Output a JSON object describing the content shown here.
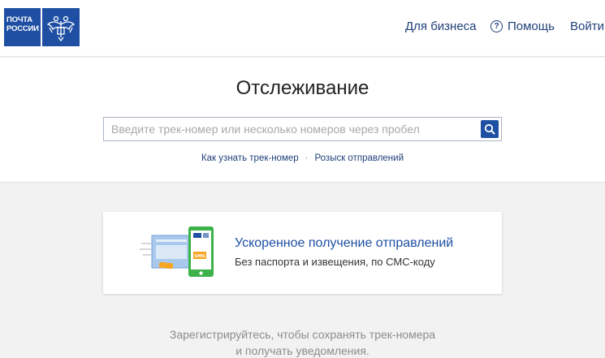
{
  "header": {
    "logo_text_line1": "ПОЧТА",
    "logo_text_line2": "РОССИИ",
    "nav": {
      "business": "Для бизнеса",
      "help": "Помощь",
      "login": "Войти"
    }
  },
  "tracking": {
    "title": "Отслеживание",
    "search_placeholder": "Введите трек-номер или несколько номеров через пробел",
    "links": {
      "how_to": "Как узнать трек-номер",
      "separator": "·",
      "search_shipments": "Розыск отправлений"
    }
  },
  "promo": {
    "title": "Ускоренное получение отправлений",
    "subtitle": "Без паспорта и извещения, по СМС-коду",
    "sms_label": "SMS"
  },
  "register": {
    "line1": "Зарегистрируйтесь, чтобы сохранять трек-номера",
    "line2": "и получать уведомления."
  },
  "colors": {
    "brand_blue": "#1e4fa3",
    "link_blue": "#1f3f7a",
    "phone_green": "#3cb24a",
    "package_orange": "#f6a623"
  }
}
